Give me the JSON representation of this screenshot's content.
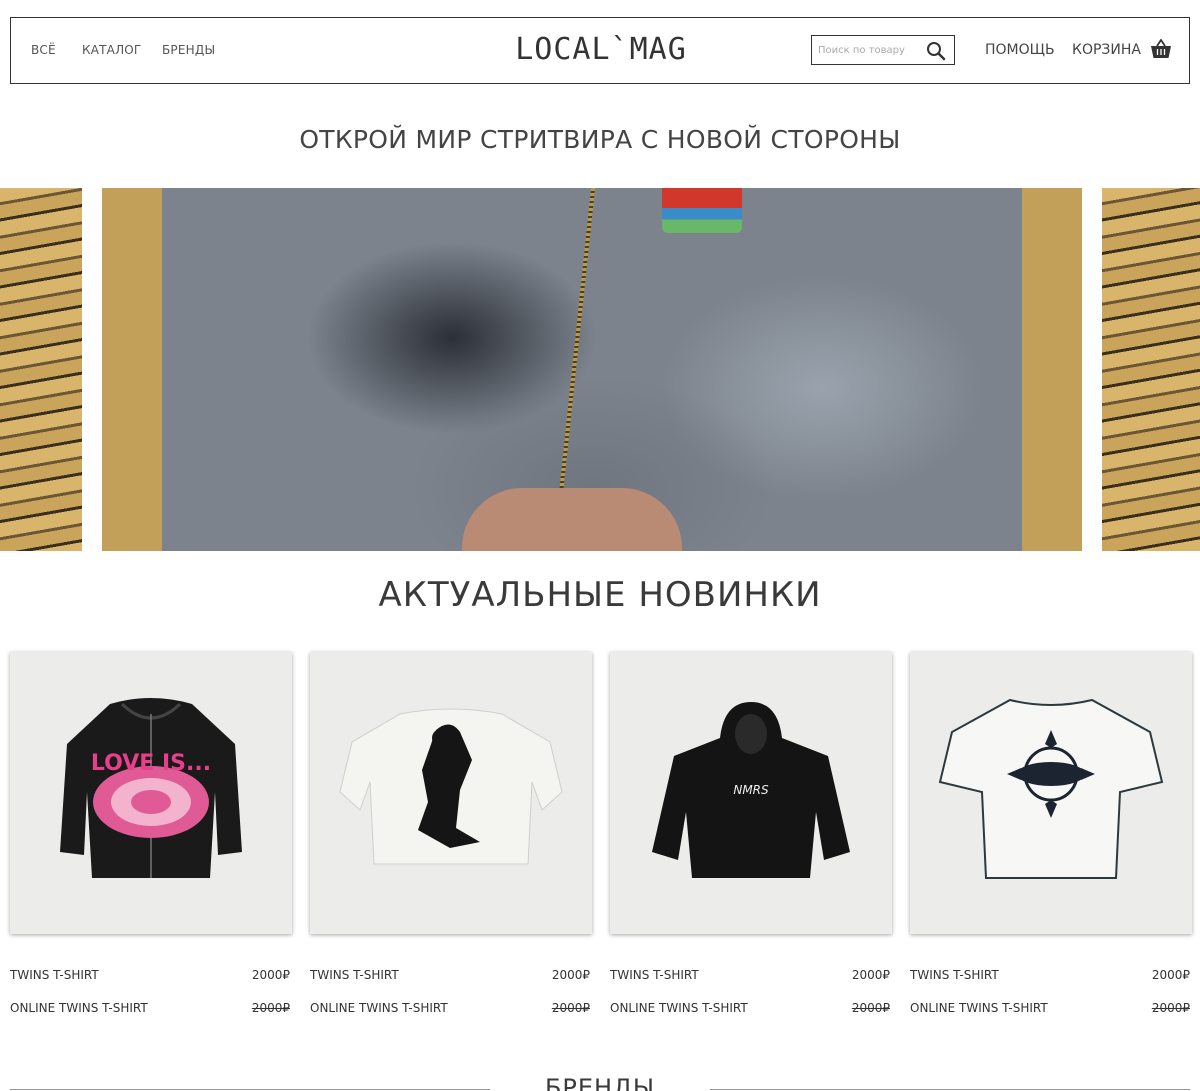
{
  "header": {
    "nav": [
      "ВСЁ",
      "КАТАЛОГ",
      "БРЕНДЫ"
    ],
    "logo": "LOCAL`MAG",
    "search_placeholder": "Поиск по товару",
    "help": "ПОМОЩЬ",
    "cart": "КОРЗИНА"
  },
  "hero": {
    "tagline": "ОТКРОЙ МИР СТРИТВИРА С НОВОЙ СТОРОНЫ"
  },
  "new_arrivals": {
    "title": "АКТУАЛЬНЫЕ НОВИНКИ",
    "products": [
      {
        "name": "TWINS T-SHIRT",
        "price": "2000₽",
        "name2": "ONLINE TWINS T-SHIRT",
        "old_price": "2000₽",
        "image": "black-zip-hoodie-pink-print"
      },
      {
        "name": "TWINS T-SHIRT",
        "price": "2000₽",
        "name2": "ONLINE TWINS T-SHIRT",
        "old_price": "2000₽",
        "image": "white-longsleeve-silhouette-print"
      },
      {
        "name": "TWINS T-SHIRT",
        "price": "2000₽",
        "name2": "ONLINE TWINS T-SHIRT",
        "old_price": "2000₽",
        "image": "black-hoodie-logo"
      },
      {
        "name": "TWINS T-SHIRT",
        "price": "2000₽",
        "name2": "ONLINE TWINS T-SHIRT",
        "old_price": "2000₽",
        "image": "white-tshirt-star-print"
      }
    ]
  },
  "brands": {
    "title": "БРЕНДЫ"
  }
}
